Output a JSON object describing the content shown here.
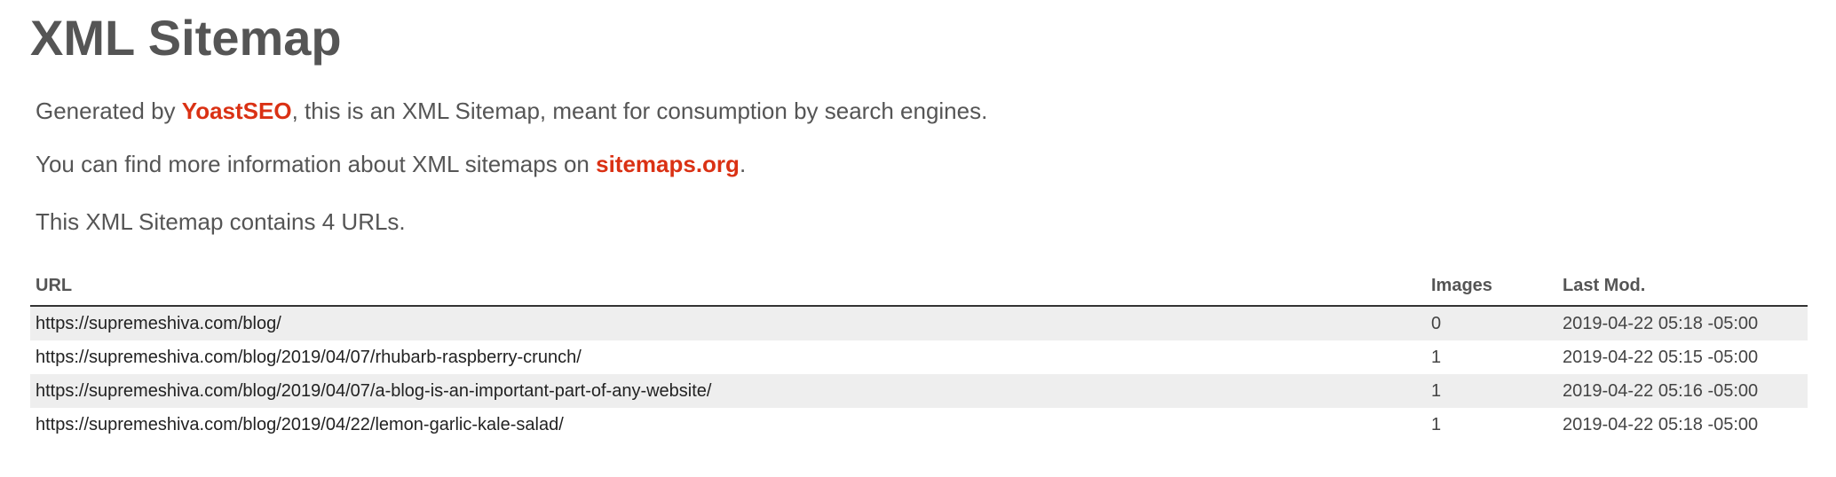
{
  "header": {
    "title": "XML Sitemap"
  },
  "description": {
    "line1_prefix": "Generated by ",
    "line1_link": "YoastSEO",
    "line1_suffix": ", this is an XML Sitemap, meant for consumption by search engines.",
    "line2_prefix": "You can find more information about XML sitemaps on ",
    "line2_link": "sitemaps.org",
    "line2_suffix": ".",
    "line3": "This XML Sitemap contains 4 URLs."
  },
  "colors": {
    "link_accent": "#da3114",
    "row_alt_bg": "#eeeeee",
    "text": "#444444"
  },
  "table": {
    "headers": {
      "url": "URL",
      "images": "Images",
      "last_mod": "Last Mod."
    },
    "rows": [
      {
        "url": "https://supremeshiva.com/blog/",
        "images": "0",
        "last_mod": "2019-04-22 05:18 -05:00"
      },
      {
        "url": "https://supremeshiva.com/blog/2019/04/07/rhubarb-raspberry-crunch/",
        "images": "1",
        "last_mod": "2019-04-22 05:15 -05:00"
      },
      {
        "url": "https://supremeshiva.com/blog/2019/04/07/a-blog-is-an-important-part-of-any-website/",
        "images": "1",
        "last_mod": "2019-04-22 05:16 -05:00"
      },
      {
        "url": "https://supremeshiva.com/blog/2019/04/22/lemon-garlic-kale-salad/",
        "images": "1",
        "last_mod": "2019-04-22 05:18 -05:00"
      }
    ]
  }
}
